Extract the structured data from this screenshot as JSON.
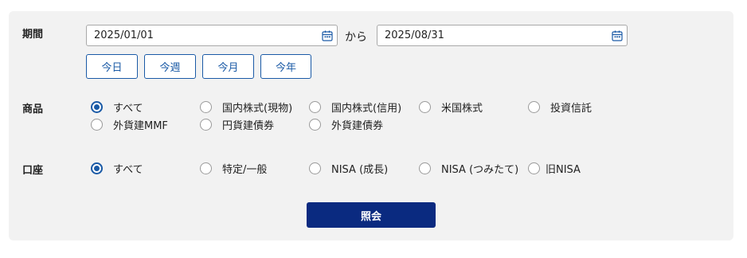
{
  "period": {
    "label": "期間",
    "from_value": "2025/01/01",
    "separator": "から",
    "to_value": "2025/08/31",
    "quick_buttons": [
      "今日",
      "今週",
      "今月",
      "今年"
    ]
  },
  "product": {
    "label": "商品",
    "selected": "すべて",
    "options": [
      "すべて",
      "国内株式(現物)",
      "国内株式(信用)",
      "米国株式",
      "投資信託",
      "外貨建MMF",
      "円貨建債券",
      "外貨建債券"
    ]
  },
  "account": {
    "label": "口座",
    "selected": "すべて",
    "options": [
      "すべて",
      "特定/一般",
      "NISA (成長)",
      "NISA (つみたて)",
      "旧NISA"
    ]
  },
  "submit_label": "照会",
  "colors": {
    "panel_bg": "#f2f2f2",
    "accent": "#1a5aa6",
    "submit_bg": "#0a2a80"
  },
  "icons": {
    "date_picker": "calendar-icon"
  }
}
